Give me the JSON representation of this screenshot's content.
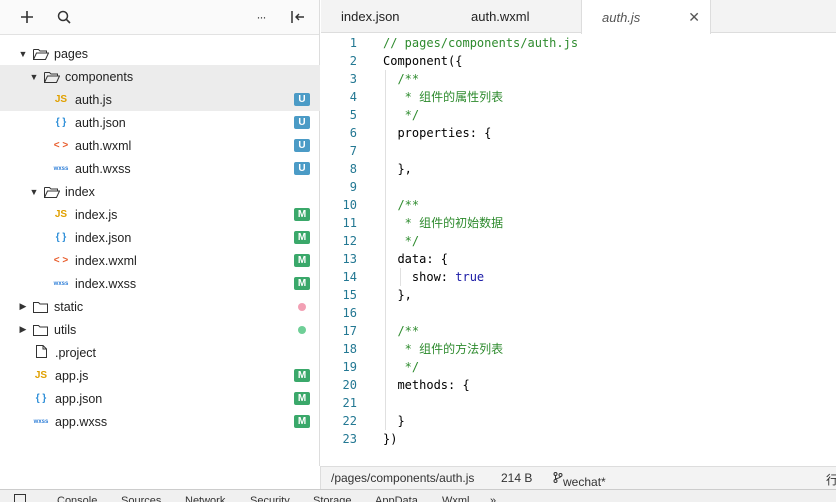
{
  "sidebar": {
    "toolbar": {
      "add_icon": "plus-icon",
      "search_icon": "search-icon",
      "more_label": "···",
      "collapse_icon": "collapse-icon"
    },
    "tree": [
      {
        "label": "pages",
        "kind": "folder",
        "expanded": true
      },
      {
        "label": "components",
        "kind": "folder",
        "expanded": true
      },
      {
        "label": "auth.js",
        "kind": "js",
        "icon_text": "JS",
        "badge": "U"
      },
      {
        "label": "auth.json",
        "kind": "json",
        "icon_text": "{ }",
        "badge": "U"
      },
      {
        "label": "auth.wxml",
        "kind": "wxml",
        "icon_text": "< >",
        "badge": "U"
      },
      {
        "label": "auth.wxss",
        "kind": "wxss",
        "icon_text": "wxss",
        "badge": "U"
      },
      {
        "label": "index",
        "kind": "folder",
        "expanded": true
      },
      {
        "label": "index.js",
        "kind": "js",
        "icon_text": "JS",
        "badge": "M"
      },
      {
        "label": "index.json",
        "kind": "json",
        "icon_text": "{ }",
        "badge": "M"
      },
      {
        "label": "index.wxml",
        "kind": "wxml",
        "icon_text": "< >",
        "badge": "M"
      },
      {
        "label": "index.wxss",
        "kind": "wxss",
        "icon_text": "wxss",
        "badge": "M"
      },
      {
        "label": "static",
        "kind": "folder",
        "expanded": false,
        "dot_color": "#f2a0b4"
      },
      {
        "label": "utils",
        "kind": "folder",
        "expanded": false,
        "dot_color": "#6fcf97"
      },
      {
        "label": ".project",
        "kind": "file"
      },
      {
        "label": "app.js",
        "kind": "js",
        "icon_text": "JS",
        "badge": "M"
      },
      {
        "label": "app.json",
        "kind": "json",
        "icon_text": "{ }",
        "badge": "M"
      },
      {
        "label": "app.wxss",
        "kind": "wxss",
        "icon_text": "wxss",
        "badge": "M"
      }
    ]
  },
  "editor": {
    "tabs": [
      {
        "label": "index.json"
      },
      {
        "label": "auth.wxml"
      },
      {
        "label": "auth.js",
        "active": true
      }
    ],
    "close_label": "✕",
    "code_lines": [
      {
        "n": "1",
        "tokens": [
          {
            "t": "// pages/components/auth.js",
            "c": "comment"
          }
        ]
      },
      {
        "n": "2",
        "tokens": [
          {
            "t": "Component({",
            "c": "plain"
          }
        ]
      },
      {
        "n": "3",
        "tokens": [
          {
            "t": "  /**",
            "c": "comment"
          }
        ]
      },
      {
        "n": "4",
        "tokens": [
          {
            "t": "   * 组件的属性列表",
            "c": "comment"
          }
        ]
      },
      {
        "n": "5",
        "tokens": [
          {
            "t": "   */",
            "c": "comment"
          }
        ]
      },
      {
        "n": "6",
        "tokens": [
          {
            "t": "  properties: {",
            "c": "plain"
          }
        ]
      },
      {
        "n": "7",
        "tokens": [
          {
            "t": "",
            "c": "plain"
          }
        ]
      },
      {
        "n": "8",
        "tokens": [
          {
            "t": "  },",
            "c": "plain"
          }
        ]
      },
      {
        "n": "9",
        "tokens": [
          {
            "t": "",
            "c": "plain"
          }
        ]
      },
      {
        "n": "10",
        "tokens": [
          {
            "t": "  /**",
            "c": "comment"
          }
        ]
      },
      {
        "n": "11",
        "tokens": [
          {
            "t": "   * 组件的初始数据",
            "c": "comment"
          }
        ]
      },
      {
        "n": "12",
        "tokens": [
          {
            "t": "   */",
            "c": "comment"
          }
        ]
      },
      {
        "n": "13",
        "tokens": [
          {
            "t": "  data: {",
            "c": "plain"
          }
        ]
      },
      {
        "n": "14",
        "tokens": [
          {
            "t": "    show: ",
            "c": "plain"
          },
          {
            "t": "true",
            "c": "keyword"
          }
        ]
      },
      {
        "n": "15",
        "tokens": [
          {
            "t": "  },",
            "c": "plain"
          }
        ]
      },
      {
        "n": "16",
        "tokens": [
          {
            "t": "",
            "c": "plain"
          }
        ]
      },
      {
        "n": "17",
        "tokens": [
          {
            "t": "  /**",
            "c": "comment"
          }
        ]
      },
      {
        "n": "18",
        "tokens": [
          {
            "t": "   * 组件的方法列表",
            "c": "comment"
          }
        ]
      },
      {
        "n": "19",
        "tokens": [
          {
            "t": "   */",
            "c": "comment"
          }
        ]
      },
      {
        "n": "20",
        "tokens": [
          {
            "t": "  methods: {",
            "c": "plain"
          }
        ]
      },
      {
        "n": "21",
        "tokens": [
          {
            "t": "",
            "c": "plain"
          }
        ]
      },
      {
        "n": "22",
        "tokens": [
          {
            "t": "  }",
            "c": "plain"
          }
        ]
      },
      {
        "n": "23",
        "tokens": [
          {
            "t": "})",
            "c": "plain"
          }
        ]
      }
    ]
  },
  "statusbar": {
    "path": "/pages/components/auth.js",
    "size": "214 B",
    "branch": "wechat*",
    "right_glyph": "行"
  },
  "bottom_tabs": [
    "Console",
    "Sources",
    "Network",
    "Security",
    "Storage",
    "AppData",
    "Wxml",
    "»"
  ],
  "colors": {
    "comment": "#2e8b2e",
    "keyword": "#1a1aa6",
    "line_number": "#237893",
    "badge_U": "#4b9bc6",
    "badge_M": "#3aa86a"
  }
}
